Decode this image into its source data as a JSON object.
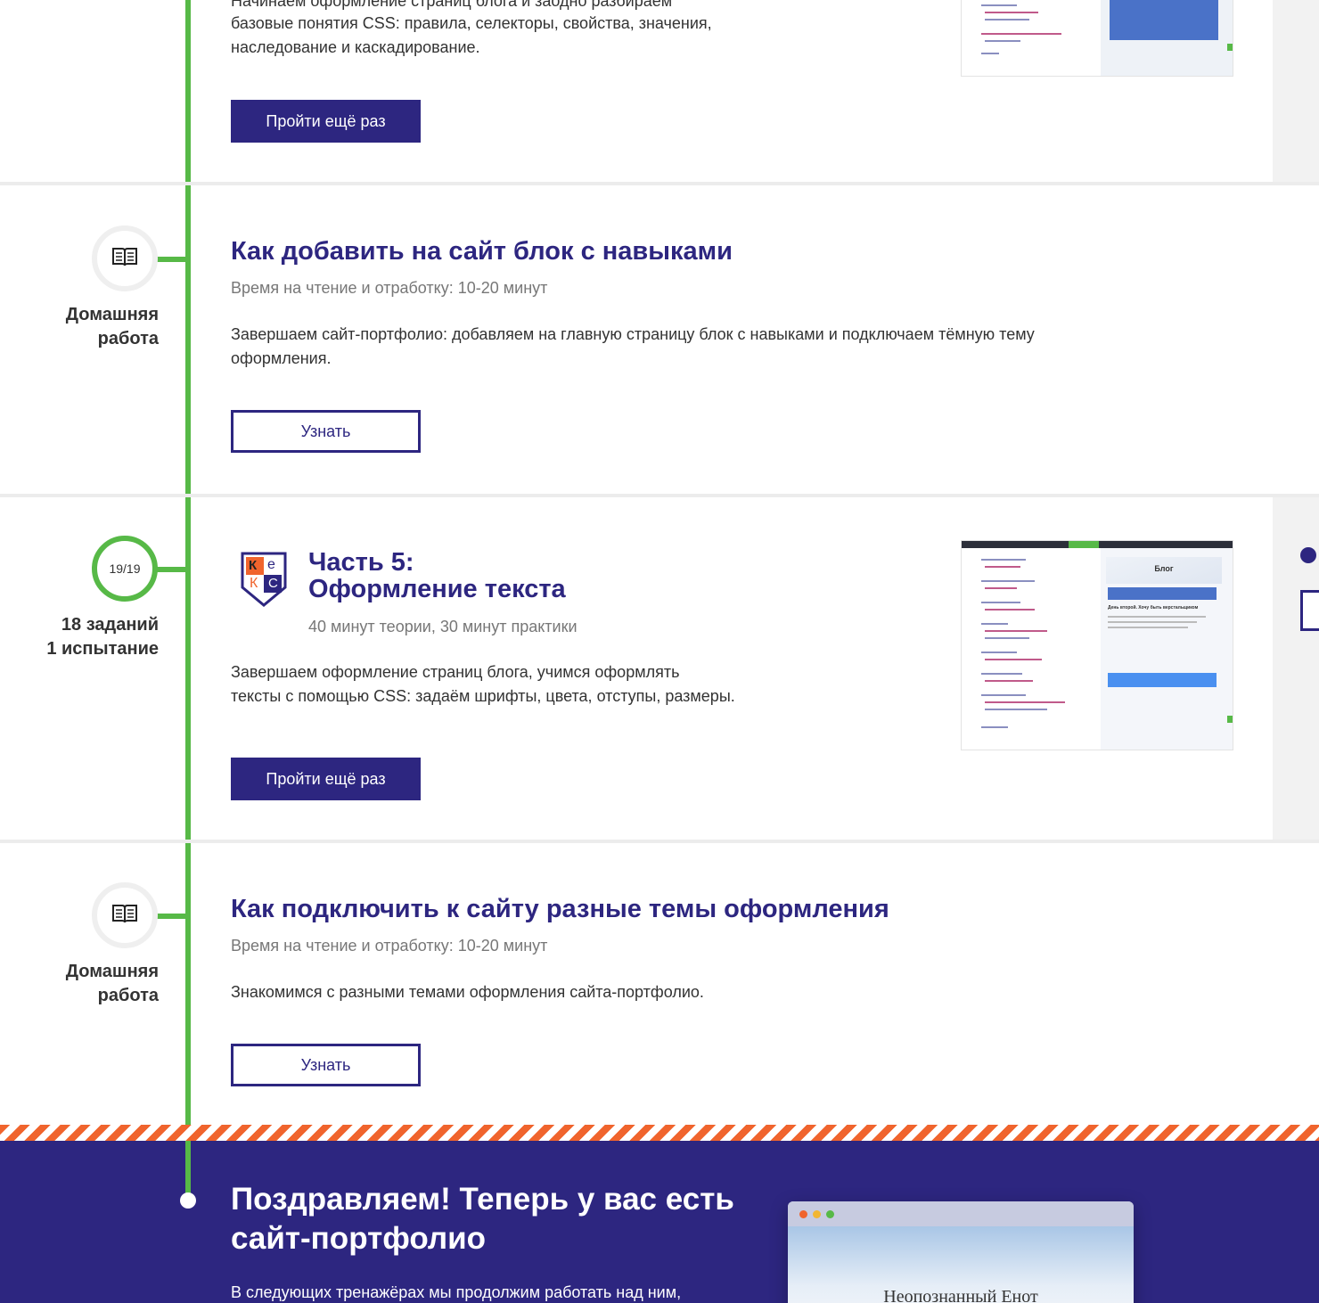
{
  "section1": {
    "desc_partial": "Начинаем оформление страниц блога и заодно разбираем",
    "desc_lines": [
      "базовые понятия CSS: правила, селекторы, свойства, значения,",
      "наследование и каскадирование."
    ],
    "button": "Пройти ещё раз"
  },
  "homework1": {
    "side_lines": [
      "Домашняя",
      "работа"
    ],
    "icon": "book-icon",
    "title": "Как добавить на сайт блок с навыками",
    "meta": "Время на чтение и отработку: 10-20 минут",
    "desc_lines": [
      "Завершаем сайт-портфолио: добавляем на главную страницу блок с навыками и подключаем тёмную тему",
      "оформления."
    ],
    "button": "Узнать"
  },
  "part5": {
    "progress": "19/19",
    "side_lines": [
      "18 заданий",
      "1 испытание"
    ],
    "logo_letters": [
      "К",
      "е",
      "К",
      "С"
    ],
    "title_lines": [
      "Часть 5:",
      "Оформление текста"
    ],
    "meta": "40 минут теории, 30 минут практики",
    "desc_lines": [
      "Завершаем оформление страниц блога, учимся оформлять",
      "тексты с помощью CSS: задаём шрифты, цвета, отступы, размеры."
    ],
    "button": "Пройти ещё раз",
    "preview_title": "Блог",
    "preview_heading": "День второй. Хочу быть верстальщиком"
  },
  "homework2": {
    "side_lines": [
      "Домашняя",
      "работа"
    ],
    "icon": "book-icon",
    "title": "Как подключить к сайту разные темы оформления",
    "meta": "Время на чтение и отработку: 10-20 минут",
    "desc": "Знакомимся с разными темами оформления сайта-портфолио.",
    "button": "Узнать"
  },
  "final": {
    "title_lines": [
      "Поздравляем! Теперь у вас есть",
      "сайт-портфолио"
    ],
    "desc_partial": "В следующих тренажёрах мы продолжим работать над ним,",
    "preview_site_name": "Неопознанный Енот"
  },
  "colors": {
    "accent": "#2d2680",
    "timeline": "#57b947",
    "stripe": "#f0642d"
  }
}
